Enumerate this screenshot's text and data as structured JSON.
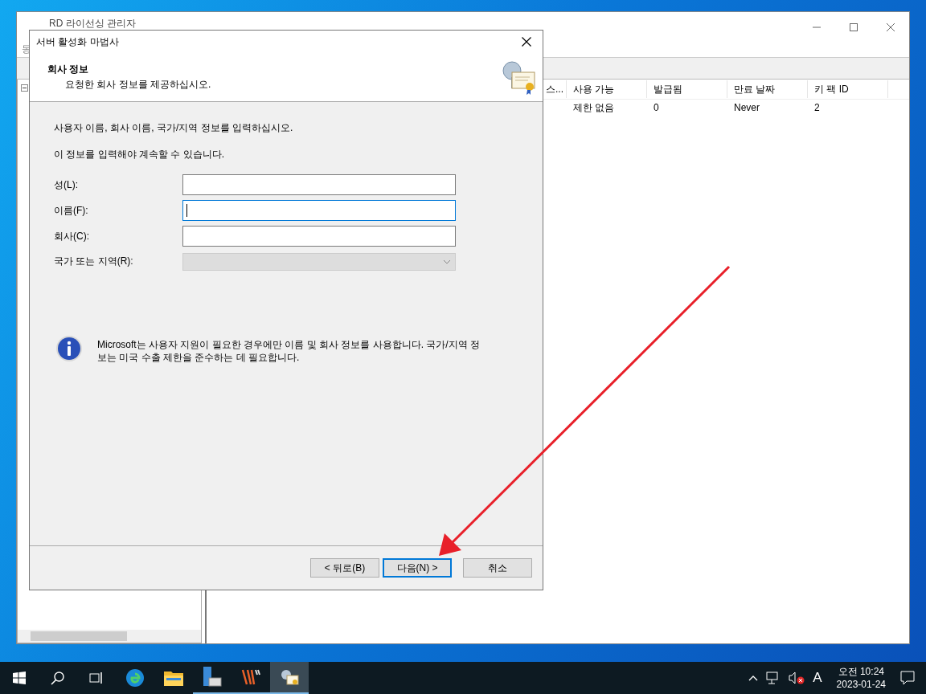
{
  "main_window": {
    "title": "RD 라이선싱 관리자",
    "menu_partial": "동",
    "columns": [
      "스...",
      "사용 가능",
      "발급됨",
      "만료 날짜",
      "키 팩 ID"
    ],
    "rows": [
      [
        "",
        "제한 없음",
        "0",
        "Never",
        "2"
      ]
    ]
  },
  "dialog": {
    "title": "서버 활성화 마법사",
    "heading": "회사 정보",
    "subheading": "요청한 회사 정보를 제공하십시오.",
    "instructions": [
      "사용자 이름, 회사 이름, 국가/지역 정보를 입력하십시오.",
      "이 정보를 입력해야 계속할 수 있습니다."
    ],
    "fields": [
      {
        "kind": "text",
        "label": "성(L):",
        "focused": false,
        "disabled": false
      },
      {
        "kind": "text",
        "label": "이름(F):",
        "focused": true,
        "disabled": false
      },
      {
        "kind": "text",
        "label": "회사(C):",
        "focused": false,
        "disabled": false
      },
      {
        "kind": "combo",
        "label": "국가 또는 지역(R):",
        "focused": false,
        "disabled": true
      }
    ],
    "info": "Microsoft는 사용자 지원이 필요한 경우에만 이름 및 회사 정보를 사용합니다. 국가/지역 정보는 미국 수출 제한을 준수하는 데 필요합니다.",
    "buttons": [
      {
        "label": "< 뒤로(B)",
        "default": false
      },
      {
        "label": "다음(N) >",
        "default": true
      },
      {
        "label": "취소",
        "default": false
      }
    ]
  },
  "taskbar": {
    "apps": [
      {
        "kind": "edge",
        "running": false,
        "active": false
      },
      {
        "kind": "folder",
        "running": false,
        "active": false
      },
      {
        "kind": "server",
        "running": true,
        "active": false
      },
      {
        "kind": "stripes",
        "running": true,
        "active": false
      },
      {
        "kind": "license",
        "running": true,
        "active": true
      }
    ],
    "ime": "A",
    "time": "오전 10:24",
    "date": "2023-01-24"
  }
}
